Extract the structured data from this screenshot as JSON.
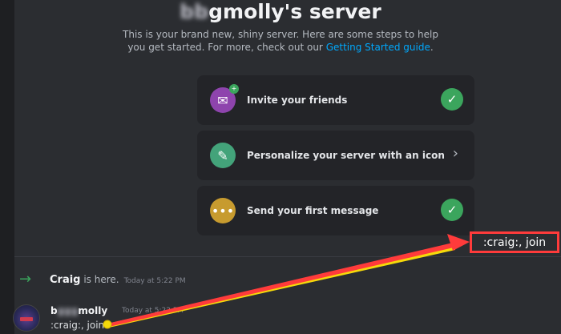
{
  "server": {
    "title_blurred": "b",
    "title_suffix": "gmolly's server",
    "subtitle_1": "This is your brand new, shiny server. Here are some steps to help",
    "subtitle_2": "you get started. For more, check out our ",
    "subtitle_link": "Getting Started guide",
    "subtitle_end": "."
  },
  "checklist": [
    {
      "label": "Invite your friends",
      "icon": "invite-friends-icon",
      "color": "#8e44ad",
      "done": true
    },
    {
      "label": "Personalize your server with an icon",
      "icon": "paint-brush-icon",
      "color": "#43a37a",
      "done": false
    },
    {
      "label": "Send your first message",
      "icon": "chat-bubble-icon",
      "color": "#c79b2f",
      "done": true
    }
  ],
  "join_message": {
    "user": "Craig",
    "text": " is here.",
    "timestamp": "Today at 5:22 PM"
  },
  "message": {
    "author_blurred": "b",
    "author_suffix": "molly",
    "timestamp": "Today at 5:22 PM",
    "text": ":craig:, join"
  },
  "annotation": {
    "text": ":craig:, join",
    "color": "#ff3b3b",
    "dot_color": "#f5d90a"
  }
}
